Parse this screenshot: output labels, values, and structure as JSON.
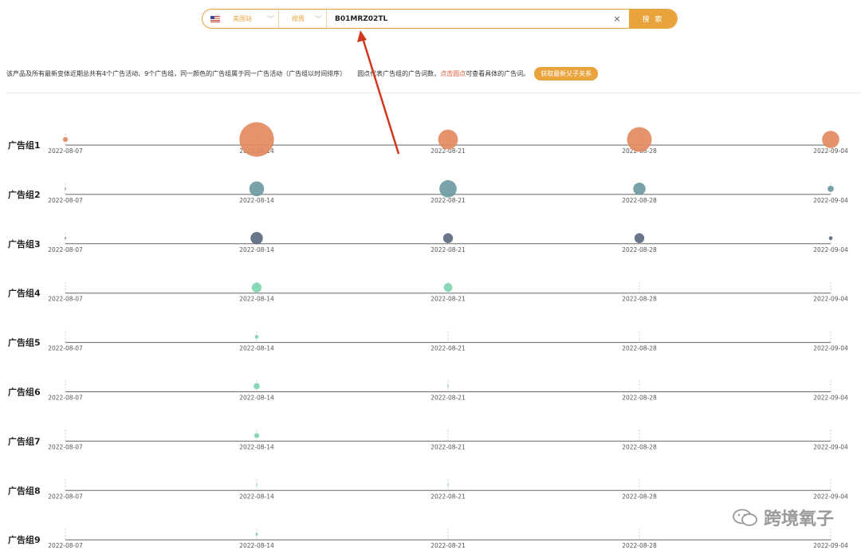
{
  "search": {
    "site_label": "美国站",
    "period_label": "按周",
    "query": "B01MRZ02TL",
    "clear_icon": "×",
    "button_label": "搜 索"
  },
  "info": {
    "text_main": "该产品及所有最新变体近期总共有4个广告活动、9个广告组，同一颜色的广告组属于同一广告活动（广告组以时间排序）",
    "text_legend_prefix": "圆点代表广告组的广告词数，",
    "text_legend_link": "点击圆点",
    "text_legend_suffix": "可查看具体的广告词。",
    "parent_button": "获取最新父子关系"
  },
  "colors": {
    "accent": "#e8a33d",
    "campaign_1": "#e28a5f",
    "campaign_2": "#6e9aa2",
    "campaign_3": "#5a6a7f",
    "campaign_4": "#7fd5b0"
  },
  "dates": [
    "2022-08-07",
    "2022-08-14",
    "2022-08-21",
    "2022-08-28",
    "2022-09-04"
  ],
  "ad_groups": [
    {
      "name": "广告组1",
      "color": "#e28a5f",
      "sizes": [
        2,
        14,
        8,
        10,
        7
      ]
    },
    {
      "name": "广告组2",
      "color": "#6e9aa2",
      "sizes": [
        0.5,
        6,
        7,
        5,
        2.5
      ]
    },
    {
      "name": "广告组3",
      "color": "#5a6a7f",
      "sizes": [
        0.5,
        5,
        4,
        4,
        1.5
      ]
    },
    {
      "name": "广告组4",
      "color": "#7fd5b0",
      "sizes": [
        0,
        4,
        3.5,
        0,
        0
      ]
    },
    {
      "name": "广告组5",
      "color": "#7fd5b0",
      "sizes": [
        0,
        1.5,
        0,
        0,
        0
      ]
    },
    {
      "name": "广告组6",
      "color": "#7fd5b0",
      "sizes": [
        0,
        2.5,
        0.5,
        0,
        0
      ]
    },
    {
      "name": "广告组7",
      "color": "#7fd5b0",
      "sizes": [
        0,
        2,
        0,
        0,
        0
      ]
    },
    {
      "name": "广告组8",
      "color": "#7fd5b0",
      "sizes": [
        0,
        0.6,
        0.6,
        0,
        0
      ]
    },
    {
      "name": "广告组9",
      "color": "#7fd5b0",
      "sizes": [
        0,
        1,
        0,
        0,
        0
      ]
    }
  ],
  "watermark": {
    "text": "跨境氧子",
    "icon": "wechat-icon"
  }
}
